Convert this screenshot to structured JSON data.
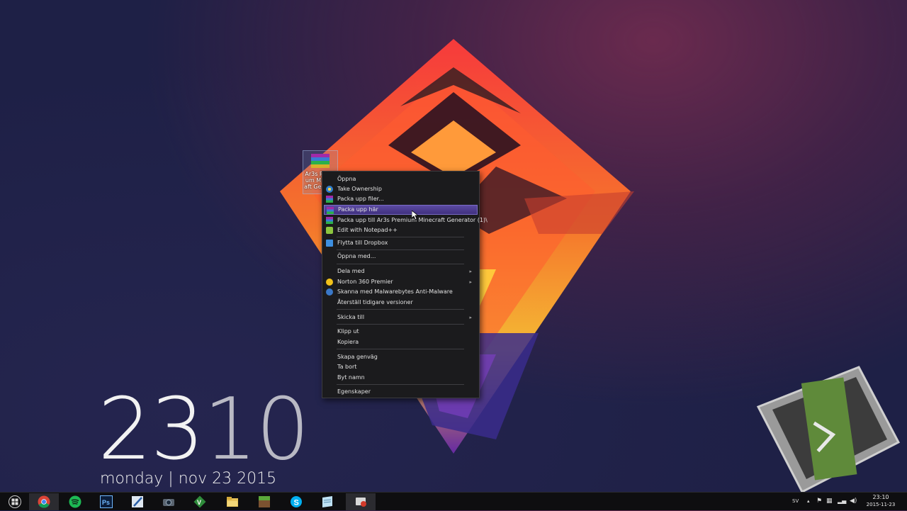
{
  "desktop": {
    "icon_label": "Ar3s Premium Minecraft Generator"
  },
  "context_menu": {
    "items": [
      {
        "label": "Öppna",
        "icon": "none"
      },
      {
        "label": "Take Ownership",
        "icon": "shield-icon"
      },
      {
        "label": "Packa upp filer...",
        "icon": "winrar-icon"
      },
      {
        "label": "Packa upp här",
        "icon": "winrar-icon",
        "highlighted": true
      },
      {
        "label": "Packa upp till Ar3s Premium Minecraft Generator (1)\\",
        "icon": "winrar-icon"
      },
      {
        "label": "Edit with Notepad++",
        "icon": "notepad-icon"
      },
      {
        "label": "Flytta till Dropbox",
        "icon": "dropbox-icon"
      },
      {
        "label": "Öppna med...",
        "icon": "none"
      },
      {
        "label": "Dela med",
        "icon": "none",
        "submenu": true
      },
      {
        "label": "Norton 360 Premier",
        "icon": "norton-icon",
        "submenu": true
      },
      {
        "label": "Skanna med Malwarebytes Anti-Malware",
        "icon": "malwarebytes-icon"
      },
      {
        "label": "Återställ tidigare versioner",
        "icon": "none"
      },
      {
        "label": "Skicka till",
        "icon": "none",
        "submenu": true
      },
      {
        "label": "Klipp ut",
        "icon": "none"
      },
      {
        "label": "Kopiera",
        "icon": "none"
      },
      {
        "label": "Skapa genväg",
        "icon": "none"
      },
      {
        "label": "Ta bort",
        "icon": "none"
      },
      {
        "label": "Byt namn",
        "icon": "none"
      },
      {
        "label": "Egenskaper",
        "icon": "none"
      }
    ]
  },
  "clock_widget": {
    "hours": "23",
    "minutes": "10",
    "date_line": "monday | nov 23 2015"
  },
  "taskbar": {
    "apps": [
      "start-icon",
      "chrome-icon",
      "spotify-icon",
      "photoshop-icon",
      "pen-icon",
      "camera-icon",
      "vim-icon",
      "folder-icon",
      "minecraft-icon",
      "skype-icon",
      "notes-icon",
      "recorder-icon"
    ],
    "language": "SV",
    "time": "23:10",
    "date": "2015-11-23"
  },
  "colors": {
    "highlight": "#4f3f96",
    "menu_bg": "#1b1b1d",
    "accent_orange": "#ff6a2a",
    "camtasia_green": "#5f8a3a"
  }
}
